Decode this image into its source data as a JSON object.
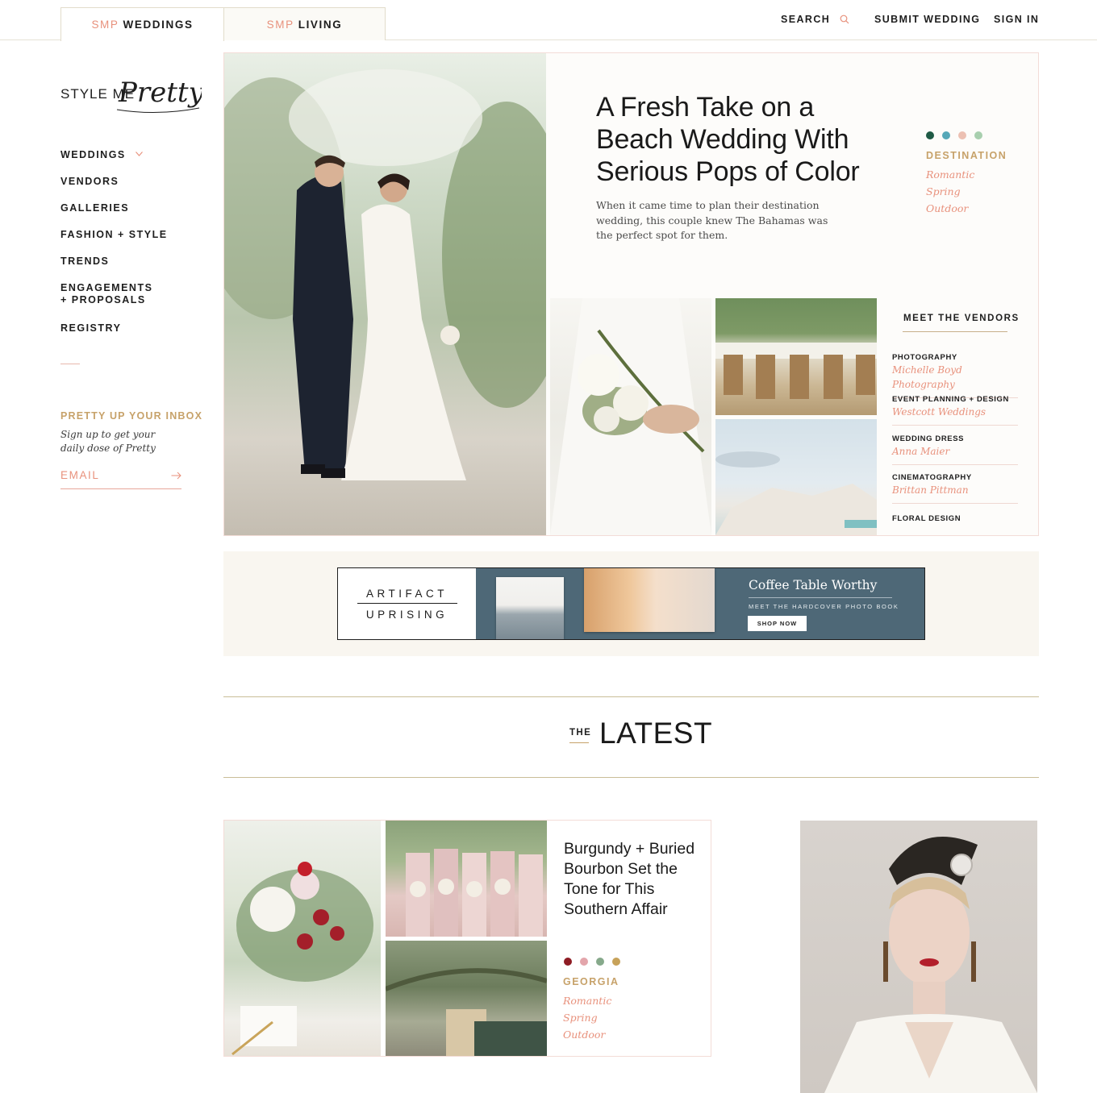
{
  "header": {
    "tabs": [
      {
        "prefix": "SMP",
        "label": "WEDDINGS"
      },
      {
        "prefix": "SMP",
        "label": "LIVING"
      }
    ],
    "search_label": "SEARCH",
    "submit_label": "SUBMIT WEDDING",
    "signin_label": "SIGN IN"
  },
  "sidebar": {
    "logo_left": "STYLE ME",
    "logo_right": "Pretty",
    "items": [
      {
        "label": "WEDDINGS"
      },
      {
        "label": "VENDORS"
      },
      {
        "label": "GALLERIES"
      },
      {
        "label": "FASHION + STYLE"
      },
      {
        "label": "TRENDS"
      },
      {
        "label": "ENGAGEMENTS + PROPOSALS"
      },
      {
        "label": "REGISTRY"
      }
    ],
    "newsletter": {
      "title": "PRETTY UP YOUR INBOX",
      "text": "Sign up to get your daily dose of Pretty",
      "placeholder": "EMAIL"
    }
  },
  "hero": {
    "title": "A Fresh Take on a Beach Wedding With Serious Pops of Color",
    "description": "When it came time to plan their destination wedding, this couple knew The Bahamas was the perfect spot for them.",
    "palette": [
      "#1f5a45",
      "#56a8b8",
      "#ecc0b2",
      "#a8cfae"
    ],
    "category": "DESTINATION",
    "tags": [
      "Romantic",
      "Spring",
      "Outdoor"
    ],
    "vendors_title": "MEET THE VENDORS",
    "vendors": [
      {
        "role": "PHOTOGRAPHY",
        "name": "Michelle Boyd Photography"
      },
      {
        "role": "EVENT PLANNING + DESIGN",
        "name": "Westcott Weddings"
      },
      {
        "role": "WEDDING DRESS",
        "name": "Anna Maier"
      },
      {
        "role": "CINEMATOGRAPHY",
        "name": "Brittan Pittman"
      },
      {
        "role": "FLORAL DESIGN",
        "name": ""
      }
    ]
  },
  "ad": {
    "brand_line1": "ARTIFACT",
    "brand_line2": "UPRISING",
    "headline": "Coffee Table Worthy",
    "subline": "MEET THE HARDCOVER PHOTO BOOK",
    "button": "SHOP NOW"
  },
  "latest": {
    "prefix": "THE",
    "heading": "LATEST"
  },
  "article": {
    "title": "Burgundy + Buried Bourbon Set the Tone for This Southern Affair",
    "palette": [
      "#8e1c24",
      "#e3a5ab",
      "#86a98b",
      "#c7a25a"
    ],
    "category": "GEORGIA",
    "tags": [
      "Romantic",
      "Spring",
      "Outdoor"
    ]
  }
}
